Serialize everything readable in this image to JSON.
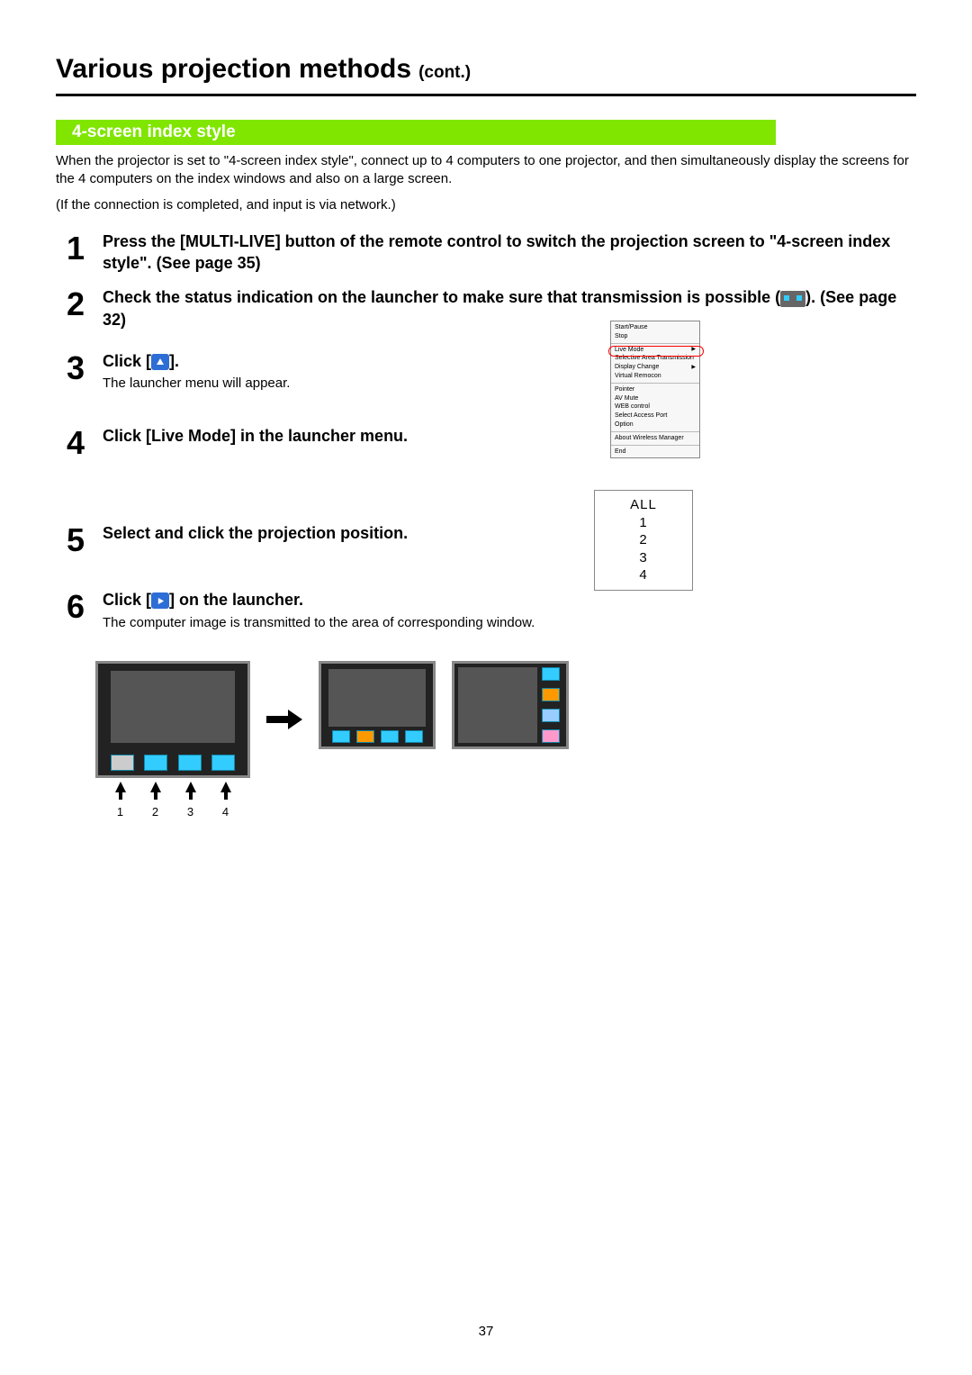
{
  "header": {
    "title": "Various projection methods",
    "cont": "(cont.)"
  },
  "section": {
    "band": "4-screen index style"
  },
  "intro": {
    "p1": "When the projector is set to \"4-screen index style\", connect up to 4 computers to one projector, and then simultaneously display the screens for the 4 computers on the index windows and also on a large screen.",
    "p2": "(If the connection is completed, and input is via network.)"
  },
  "steps": {
    "s1": {
      "num": "1",
      "text": "Press the [MULTI-LIVE] button of the remote control to switch the projection screen to \"4-screen index style\". (See page 35)"
    },
    "s2": {
      "num": "2",
      "pre": "Check the status indication on the launcher to make sure that transmission is possible (",
      "post": "). (See page 32)"
    },
    "s3": {
      "num": "3",
      "pre": "Click [",
      "post": "].",
      "sub": "The launcher menu will appear."
    },
    "s4": {
      "num": "4",
      "text": "Click [Live Mode] in the launcher menu."
    },
    "s5": {
      "num": "5",
      "text": "Select and click the projection position."
    },
    "s6": {
      "num": "6",
      "pre": "Click [",
      "post": "] on the launcher.",
      "sub": "The computer image is transmitted to the area of corresponding window."
    }
  },
  "menu": {
    "sec1": [
      "Start/Pause",
      "Stop"
    ],
    "sec2": [
      "Live Mode",
      "Selective Area Transmission",
      "Display Change",
      "Virtual Remocon"
    ],
    "sec2_arrows": {
      "Live Mode": true,
      "Display Change": true
    },
    "sec3": [
      "Pointer",
      "AV Mute",
      "WEB control",
      "Select Access Port",
      "Option"
    ],
    "sec4": [
      "About Wireless Manager"
    ],
    "sec5": [
      "End"
    ]
  },
  "positions": [
    "ALL",
    "1",
    "2",
    "3",
    "4"
  ],
  "diagram": {
    "labels": [
      "1",
      "2",
      "3",
      "4"
    ]
  },
  "page_number": "37"
}
